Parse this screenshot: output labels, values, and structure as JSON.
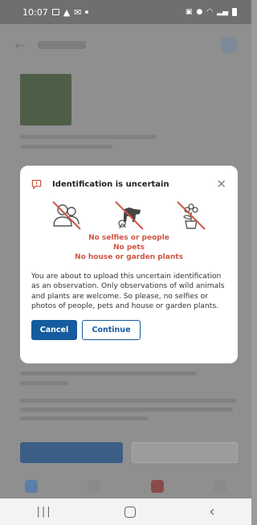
{
  "status_bar": {
    "time": "10:07"
  },
  "dialog": {
    "title": "Identification is uncertain",
    "icons": [
      "person-crossed-icon",
      "pet-crossed-icon",
      "plant-crossed-icon"
    ],
    "warnings": [
      "No selfies or people",
      "No pets",
      "No house or garden plants"
    ],
    "body": "You are about to upload this uncertain identification as an observation. Only observations of wild animals and plants are welcome. So please, no selfies or photos of people, pets and house or garden plants.",
    "cancel_label": "Cancel",
    "continue_label": "Continue"
  },
  "colors": {
    "accent": "#145c9e",
    "warning": "#cd5544"
  }
}
